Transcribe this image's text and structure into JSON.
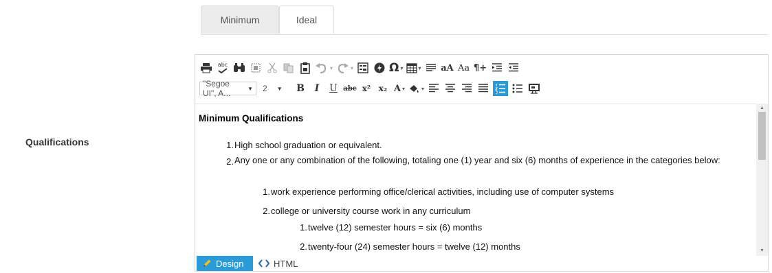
{
  "field": {
    "label": "Qualifications"
  },
  "tabs": [
    {
      "label": "Minimum",
      "active": true
    },
    {
      "label": "Ideal",
      "active": false
    }
  ],
  "toolbar": {
    "font_family": "\"Segoe UI\", A...",
    "font_size": "2",
    "row1_icons": [
      "print-icon",
      "spellcheck-icon",
      "find-icon",
      "select-all-icon",
      "cut-icon",
      "copy-icon",
      "paste-icon",
      "undo-icon",
      "redo-icon",
      "form-icon",
      "flash-icon",
      "special-char-icon",
      "table-icon",
      "paragraph-icon",
      "font-size-icon",
      "case-icon",
      "show-marks-icon",
      "indent-icon",
      "outdent-icon"
    ],
    "row2_icons": [
      "bold-icon",
      "italic-icon",
      "underline-icon",
      "strikethrough-icon",
      "superscript-icon",
      "subscript-icon",
      "font-color-icon",
      "highlight-icon",
      "align-left-icon",
      "align-center-icon",
      "align-right-icon",
      "justify-icon",
      "numbered-list-icon",
      "bullet-list-icon",
      "preview-icon"
    ],
    "glyphs": {
      "special_char": "Ω",
      "font_size_aa": "aA",
      "case_aa": "Aa",
      "pilcrow": "¶+",
      "bold": "B",
      "italic": "I",
      "underline": "U",
      "strike": "abc",
      "superscript": "x²",
      "subscript": "x₂",
      "font_color": "A",
      "spell": "abc"
    }
  },
  "content": {
    "heading": "Minimum Qualifications",
    "items": [
      {
        "num": "1.",
        "text": "High school graduation or equivalent."
      },
      {
        "num": "2.",
        "text": "Any one or any combination of the following, totaling one (1) year and six (6) months of experience in the categories below:"
      }
    ],
    "sub_items": [
      {
        "num": "1.",
        "text": "work experience performing office/clerical activities, including use of computer systems"
      },
      {
        "num": "2.",
        "text": "college or university course work in any curriculum"
      }
    ],
    "sub_sub_items": [
      {
        "num": "1.",
        "text": "twelve (12) semester hours = six (6) months"
      },
      {
        "num": "2.",
        "text": "twenty-four (24) semester hours = twelve (12) months"
      }
    ]
  },
  "modes": {
    "design": "Design",
    "html": "HTML",
    "active": "Design"
  },
  "colors": {
    "accent": "#2b9bd8",
    "tab_active_bg": "#ececec",
    "border": "#d7d7d7"
  }
}
